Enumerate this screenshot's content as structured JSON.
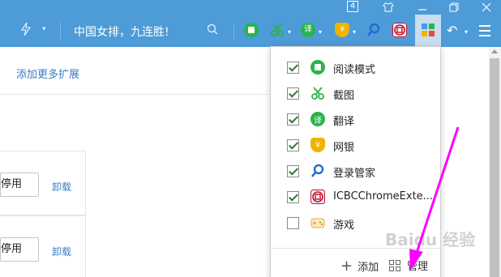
{
  "titlebar": {
    "tab_count": "4"
  },
  "toolbar": {
    "news_text": "中国女排，九连胜!",
    "extensions": [
      {
        "name": "reader-mode",
        "icon": "book-icon",
        "color": "#2cb34a"
      },
      {
        "name": "screenshot",
        "icon": "scissors-icon",
        "color": "#2cb34a"
      },
      {
        "name": "translate",
        "icon": "translate-icon",
        "color": "#2cb34a"
      },
      {
        "name": "bank",
        "icon": "yen-shield-icon",
        "color": "#f0b400"
      },
      {
        "name": "login-manager",
        "icon": "key-search-icon",
        "color": "#1f6fd1"
      },
      {
        "name": "icbc",
        "icon": "icbc-icon",
        "color": "#c8102e"
      },
      {
        "name": "extensions",
        "icon": "extensions-grid-icon",
        "color": "#2cb34a"
      }
    ]
  },
  "page": {
    "add_more_link": "添加更多扩展",
    "rows": [
      {
        "disable_label": "停用",
        "uninstall_label": "卸载"
      },
      {
        "disable_label": "停用",
        "uninstall_label": "卸载"
      }
    ]
  },
  "dropdown": {
    "items": [
      {
        "label": "阅读模式",
        "checked": true,
        "icon": "book-icon",
        "color": "#2cb34a"
      },
      {
        "label": "截图",
        "checked": true,
        "icon": "scissors-icon",
        "color": "#2cb34a"
      },
      {
        "label": "翻译",
        "checked": true,
        "icon": "translate-icon",
        "color": "#2cb34a"
      },
      {
        "label": "网银",
        "checked": true,
        "icon": "yen-shield-icon",
        "color": "#f0b400"
      },
      {
        "label": "登录管家",
        "checked": true,
        "icon": "key-search-icon",
        "color": "#1f6fd1"
      },
      {
        "label": "ICBCChromeExte...",
        "checked": true,
        "icon": "icbc-icon",
        "color": "#c8102e"
      },
      {
        "label": "游戏",
        "checked": false,
        "icon": "gamepad-icon",
        "color": "#f5a623"
      }
    ],
    "add_label": "添加",
    "manage_label": "管理"
  },
  "watermark": "Baidu 经验",
  "colors": {
    "toolbar": "#4d9bd7",
    "link": "#3b7ec4",
    "annotation_arrow": "#ff00ff"
  }
}
